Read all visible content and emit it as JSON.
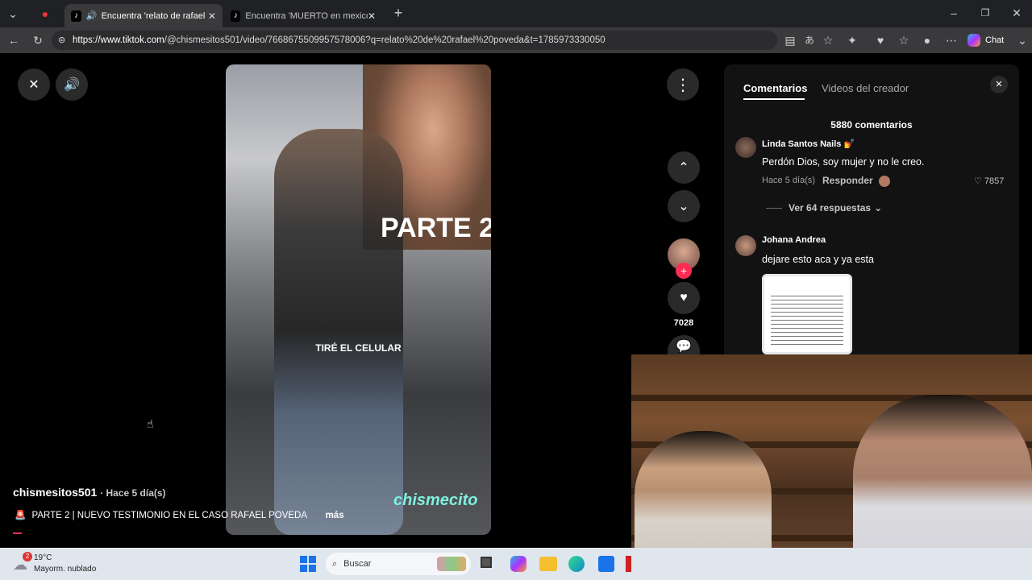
{
  "browser": {
    "tabs": [
      {
        "title": "Encuentra 'relato de rafael po",
        "active": true
      },
      {
        "title": "Encuentra 'MUERTO en mexico en",
        "active": false
      }
    ],
    "url_domain": "https://www.tiktok.com",
    "url_path": "/@chismesitos501/video/7668675509957578006?q=relato%20de%20rafael%20poveda&t=1785973330050",
    "chat_label": "Chat"
  },
  "video": {
    "overlay_title": "PARTE 2",
    "caption": "TIRÉ EL CELULAR",
    "watermark": "chismecito"
  },
  "post": {
    "username": "chismesitos501",
    "time": "· Hace 5 día(s)",
    "description": "PARTE 2 | NUEVO TESTIMONIO EN EL CASO RAFAEL POVEDA",
    "more_label": "más"
  },
  "actions": {
    "likes": "7028"
  },
  "comments_panel": {
    "tab_comments": "Comentarios",
    "tab_creator": "Videos del creador",
    "count": "5880 comentarios",
    "comments": [
      {
        "user": "Linda Santos Nails 💅",
        "text": "Perdón Dios, soy mujer y no le creo.",
        "time": "Hace 5 día(s)",
        "reply": "Responder",
        "likes": "7857",
        "replies": "Ver 64 respuestas"
      },
      {
        "user": "Johana Andrea",
        "text": "dejare esto aca y ya esta"
      }
    ]
  },
  "taskbar": {
    "badge": "2",
    "temp": "19°C",
    "weather": "Mayorm. nublado",
    "search_placeholder": "Buscar"
  },
  "colors": {
    "accent": "#fe2c55",
    "taskbar": "#dfe6ee"
  }
}
